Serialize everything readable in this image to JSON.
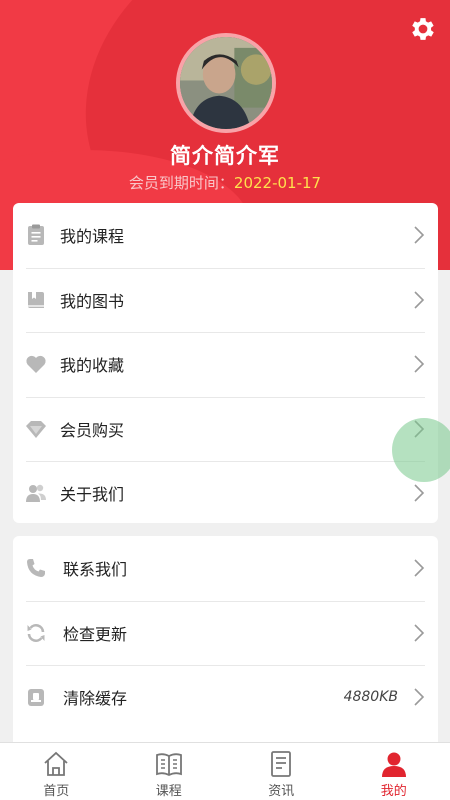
{
  "colors": {
    "brand": "#f13a45",
    "member_date": "#ffe14d",
    "active_tab": "#e1252f",
    "icon_gray": "#b8b8b8"
  },
  "profile": {
    "username": "简介简介军",
    "member_label": "会员到期时间：",
    "member_expiry": "2022-01-17",
    "settings_icon": "gear-icon"
  },
  "menu_primary": [
    {
      "label": "我的课程",
      "icon": "clipboard-icon"
    },
    {
      "label": "我的图书",
      "icon": "book-icon"
    },
    {
      "label": "我的收藏",
      "icon": "heart-icon"
    },
    {
      "label": "会员购买",
      "icon": "diamond-icon"
    },
    {
      "label": "关于我们",
      "icon": "users-icon"
    }
  ],
  "menu_secondary": [
    {
      "label": "联系我们",
      "icon": "phone-icon"
    },
    {
      "label": "检查更新",
      "icon": "refresh-icon"
    },
    {
      "label": "清除缓存",
      "icon": "cache-icon",
      "value": "4880KB"
    }
  ],
  "tabs": [
    {
      "label": "首页",
      "icon": "home-icon"
    },
    {
      "label": "课程",
      "icon": "open-book-icon"
    },
    {
      "label": "资讯",
      "icon": "document-icon"
    },
    {
      "label": "我的",
      "icon": "person-icon",
      "active": true
    }
  ]
}
